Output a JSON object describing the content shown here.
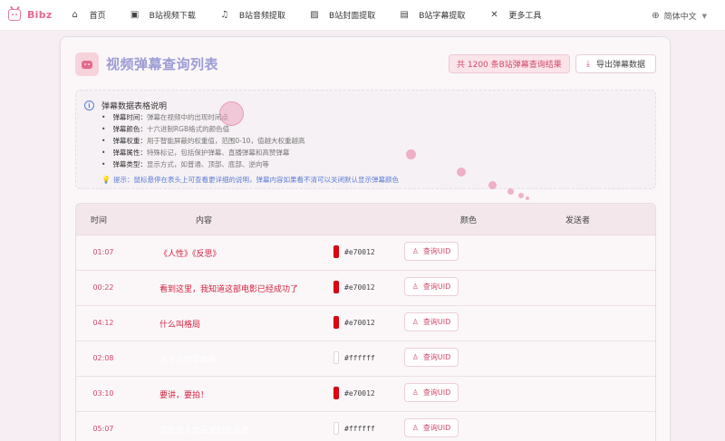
{
  "app": {
    "name": "Bibz"
  },
  "nav": {
    "items": [
      {
        "label": "首页",
        "icon": "home-icon"
      },
      {
        "label": "B站视频下载",
        "icon": "video-icon"
      },
      {
        "label": "B站音频提取",
        "icon": "music-icon"
      },
      {
        "label": "B站封面提取",
        "icon": "image-icon"
      },
      {
        "label": "B站字幕提取",
        "icon": "document-icon"
      },
      {
        "label": "更多工具",
        "icon": "tools-icon"
      }
    ],
    "language": "简体中文"
  },
  "page": {
    "title": "视频弹幕查询列表",
    "count_badge": "共 1200 条B站弹幕查询结果",
    "export_label": "导出弹幕数据"
  },
  "info": {
    "title": "弹幕数据表格说明",
    "items": [
      {
        "key": "弹幕时间：",
        "value": "弹幕在视频中的出现时间点"
      },
      {
        "key": "弹幕颜色：",
        "value": "十六进制RGB格式的颜色值"
      },
      {
        "key": "弹幕权重：",
        "value": "用于智能屏蔽的权重值，范围0-10，值越大权重越高"
      },
      {
        "key": "弹幕属性：",
        "value": "特殊标记，包括保护弹幕、直播弹幕和高赞弹幕"
      },
      {
        "key": "弹幕类型：",
        "value": "显示方式，如普通、顶部、底部、逆向等"
      }
    ],
    "tip": "提示：鼠标悬停在表头上可查看更详细的说明，弹幕内容如果看不清可以关闭默认显示弹幕颜色"
  },
  "table": {
    "headers": {
      "time": "时间",
      "content": "内容",
      "color": "颜色",
      "sender": "发送者"
    },
    "uid_label": "查询UID",
    "rows": [
      {
        "time": "01:07",
        "content": "《人性》《反思》",
        "color": "#e70012"
      },
      {
        "time": "00:22",
        "content": "看到这里，我知道这部电影已经成功了",
        "color": "#e70012"
      },
      {
        "time": "04:12",
        "content": "什么叫格局",
        "color": "#e70012"
      },
      {
        "time": "02:08",
        "content": "太子当然早都有",
        "color": "#ffffff"
      },
      {
        "time": "03:10",
        "content": "要讲，要拍！",
        "color": "#e70012"
      },
      {
        "time": "05:07",
        "content": "这就是人类最美好的品质",
        "color": "#ffffff"
      }
    ]
  },
  "colors": {
    "accent": "#e46a8e",
    "red": "#e70012",
    "white": "#ffffff",
    "link": "#5b7fd6"
  }
}
